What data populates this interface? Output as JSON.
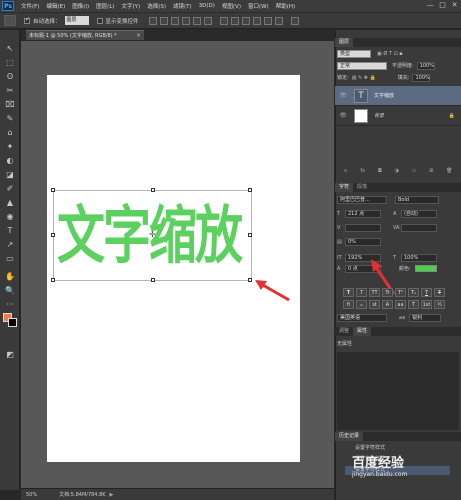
{
  "app": {
    "logo": "Ps"
  },
  "menu": [
    "文件(F)",
    "编辑(E)",
    "图像(I)",
    "图层(L)",
    "文字(Y)",
    "选择(S)",
    "滤镜(T)",
    "3D(D)",
    "视图(V)",
    "窗口(W)",
    "帮助(H)"
  ],
  "window_controls": [
    "—",
    "□",
    "✕"
  ],
  "options": {
    "auto_select_label": "自动选择：",
    "auto_select_value": "图层",
    "show_transform_label": "显示变换控件"
  },
  "document_tab": {
    "title": "未标题-1 @ 50% (文字缩放, RGB/8) *",
    "close": "×"
  },
  "canvas": {
    "text": "文字缩放"
  },
  "status": {
    "zoom": "50%",
    "doc": "文档:5.84M/784.8K"
  },
  "tools": [
    "↖",
    "⬚",
    "ʘ",
    "✂",
    "⌧",
    "✎",
    "⌂",
    "✦",
    "◐",
    "◪",
    "✐",
    "▲",
    "◉",
    "T",
    "↗",
    "▭",
    "✋",
    "🔍",
    "···",
    "◩"
  ],
  "layers_panel": {
    "tab": "图层",
    "kind_label": "类型",
    "blend_mode": "正常",
    "opacity_label": "不透明度:",
    "opacity_value": "100%",
    "lock_label": "锁定:",
    "fill_label": "填充:",
    "fill_value": "100%",
    "layers": [
      {
        "name": "文字缩放",
        "thumb": "T",
        "selected": true
      },
      {
        "name": "背景",
        "thumb": "",
        "selected": false
      }
    ]
  },
  "character_panel": {
    "tabs": [
      "字符",
      "段落"
    ],
    "font_family": "阿里巴巴普...",
    "font_style": "Bold",
    "font_size": "212 点",
    "leading": "(自动)",
    "tracking": "0%",
    "vertical_scale": "192%",
    "horizontal_scale": "100%",
    "baseline_shift": "0 点",
    "color_label": "颜色:",
    "text_color": "#4bd04b",
    "style_buttons": [
      "T",
      "T",
      "TT",
      "Tr",
      "T¹",
      "T₁",
      "T",
      "T"
    ],
    "extra_buttons": [
      "fi",
      "ℴ",
      "st",
      "A",
      "aa",
      "T",
      "1st",
      "½"
    ],
    "language": "美国英语",
    "antialias": "锐利",
    "aa_label": "aa"
  },
  "properties_panel": {
    "tabs": [
      "调整",
      "属性"
    ],
    "content": "无属性"
  },
  "history_panel": {
    "tab": "历史记录",
    "items": [
      "设置字符样式",
      "设置字符样式",
      "设置字符样式"
    ]
  },
  "watermark": {
    "text": "百度经验",
    "sub": "jingyan.baidu.com"
  },
  "colors": {
    "accent_green": "#5cd160",
    "arrow_red": "#e53030",
    "foreground": "#f07a4a",
    "background": "#000000"
  }
}
